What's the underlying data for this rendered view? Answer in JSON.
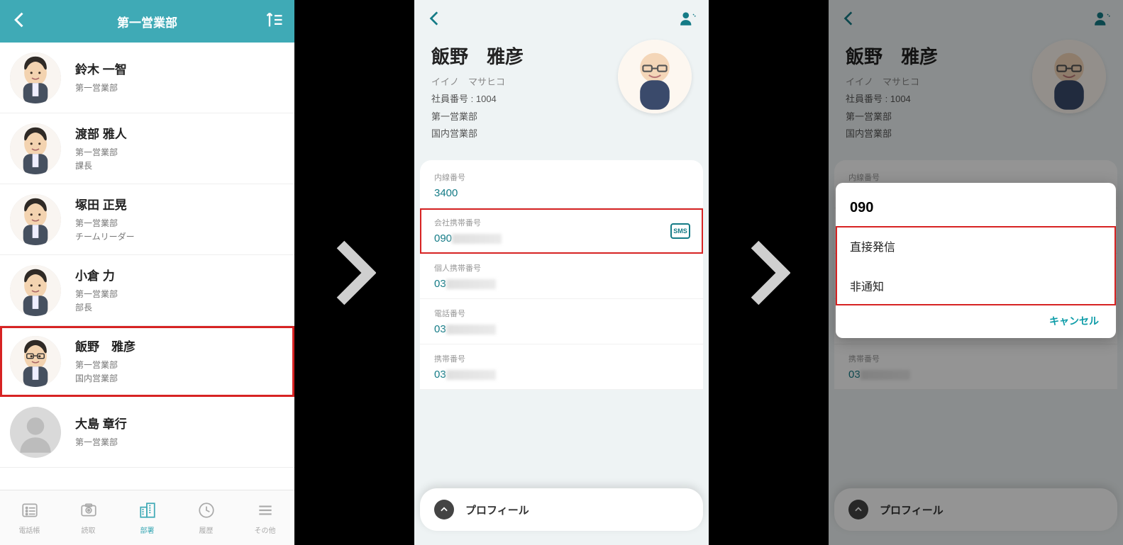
{
  "colors": {
    "accent": "#3faab6",
    "danger": "#d72323",
    "tealText": "#147b86"
  },
  "screen1": {
    "header": {
      "title": "第一営業部"
    },
    "contacts": [
      {
        "name": "鈴木 一智",
        "lines": [
          "第一営業部"
        ]
      },
      {
        "name": "渡部 雅人",
        "lines": [
          "第一営業部",
          "課長"
        ]
      },
      {
        "name": "塚田 正晃",
        "lines": [
          "第一営業部",
          "チームリーダー"
        ]
      },
      {
        "name": "小倉 力",
        "lines": [
          "第一営業部",
          "部長"
        ]
      },
      {
        "name": "飯野　雅彦",
        "lines": [
          "第一営業部",
          "国内営業部"
        ],
        "highlight": true,
        "glasses": true
      },
      {
        "name": "大島 章行",
        "lines": [
          "第一営業部"
        ],
        "placeholder": true
      }
    ],
    "tabs": [
      {
        "label": "電話帳"
      },
      {
        "label": "読取"
      },
      {
        "label": "部署",
        "active": true
      },
      {
        "label": "履歴"
      },
      {
        "label": "その他"
      }
    ]
  },
  "screen2": {
    "name": "飯野　雅彦",
    "kana": "イイノ　マサヒコ",
    "empno_label": "社員番号 :",
    "empno": "1004",
    "orgs": [
      "第一営業部",
      "国内営業部"
    ],
    "rows": [
      {
        "label": "内線番号",
        "value": "3400"
      },
      {
        "label": "会社携帯番号",
        "prefix": "090",
        "masked": true,
        "sms": true,
        "hl": true
      },
      {
        "label": "個人携帯番号",
        "prefix": "03",
        "masked": true
      },
      {
        "label": "電話番号",
        "prefix": "03",
        "masked": true
      },
      {
        "label": "携帯番号",
        "prefix": "03",
        "masked": true
      }
    ],
    "profile_bar": "プロフィール"
  },
  "screen3": {
    "dialog": {
      "title_prefix": "090",
      "options": [
        "直接発信",
        "非通知"
      ],
      "cancel": "キャンセル"
    }
  }
}
